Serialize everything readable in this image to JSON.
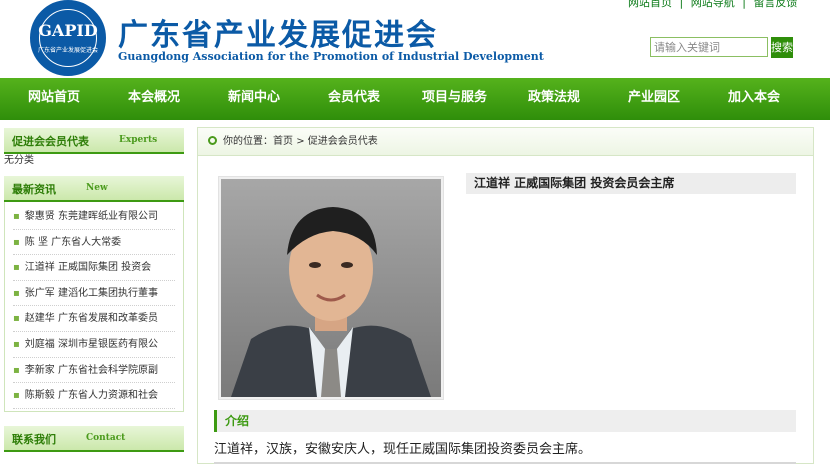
{
  "header": {
    "logo_text": "GAPID",
    "logo_subtext": "广东省产业发展促进会",
    "title": "广东省产业发展促进会",
    "subtitle": "Guangdong Association for the Promotion of Industrial Development",
    "top_links": [
      "网站首页",
      "网站导航",
      "留言反馈"
    ],
    "search_placeholder": "请输入关键词",
    "search_button": "搜索"
  },
  "nav": {
    "items": [
      "网站首页",
      "本会概况",
      "新闻中心",
      "会员代表",
      "项目与服务",
      "政策法规",
      "产业园区",
      "加入本会"
    ]
  },
  "sidebar": {
    "members": {
      "title_cn": "促进会会员代表",
      "title_en": "Experts",
      "empty_text": "无分类"
    },
    "news": {
      "title_cn": "最新资讯",
      "title_en": "New",
      "items": [
        "黎惠贤  东莞建晖纸业有限公司",
        "陈  坚  广东省人大常委",
        "江道祥  正威国际集团 投资会",
        "张广军  建滔化工集团执行董事",
        "赵建华  广东省发展和改革委员",
        "刘庭福  深圳市星银医药有限公",
        "李新家  广东省社会科学院原副",
        "陈斯毅  广东省人力资源和社会"
      ]
    },
    "contact": {
      "title_cn": "联系我们",
      "title_en": "Contact"
    }
  },
  "main": {
    "breadcrumb": {
      "prefix": "你的位置：",
      "home": "首页",
      "sep": ">",
      "current": "促进会会员代表"
    },
    "person_title": "江道祥  正威国际集团 投资会员会主席",
    "intro_heading": "介绍",
    "intro_text": "江道祥，汉族，安徽安庆人，现任正威国际集团投资委员会主席。"
  },
  "colors": {
    "brand_blue": "#0b5aa6",
    "brand_green": "#3d9a12",
    "nav_green": "#2f8e0a"
  }
}
